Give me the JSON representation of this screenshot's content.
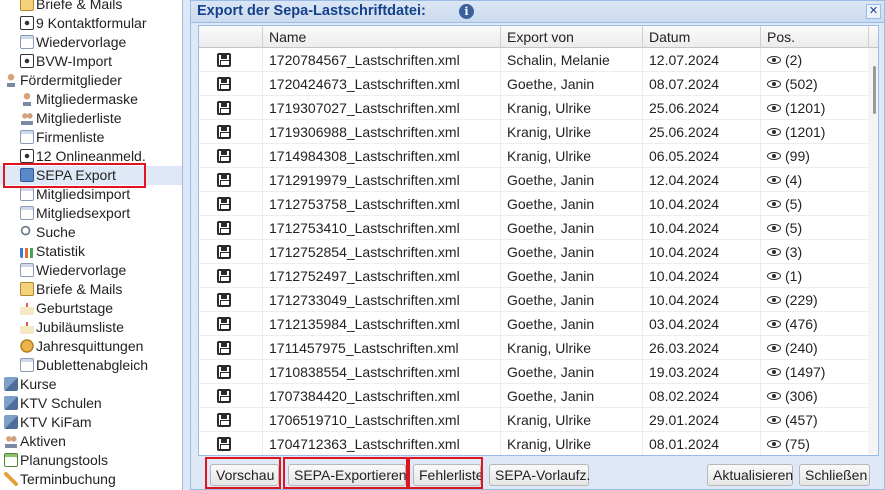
{
  "sidebar": {
    "items": [
      {
        "label": "Briefe & Mails",
        "icon": "mail-icon",
        "level": 1
      },
      {
        "label": "9  Kontaktformular",
        "icon": "eye-icon",
        "level": 1
      },
      {
        "label": "Wiedervorlage",
        "icon": "document-icon",
        "level": 1
      },
      {
        "label": "BVW-Import",
        "icon": "eye-icon",
        "level": 1
      },
      {
        "label": "Fördermitglieder",
        "icon": "person-icon",
        "level": 0
      },
      {
        "label": "Mitgliedermaske",
        "icon": "person-icon",
        "level": 1
      },
      {
        "label": "Mitgliederliste",
        "icon": "group-icon",
        "level": 1
      },
      {
        "label": "Firmenliste",
        "icon": "document-icon",
        "level": 1
      },
      {
        "label": "12  Onlineanmeld.",
        "icon": "eye-icon",
        "level": 1
      },
      {
        "label": "SEPA Export",
        "icon": "sepa-icon",
        "level": 1,
        "selected": true
      },
      {
        "label": "Mitgliedsimport",
        "icon": "document-icon",
        "level": 1
      },
      {
        "label": "Mitgliedsexport",
        "icon": "document-icon",
        "level": 1
      },
      {
        "label": "Suche",
        "icon": "search-icon",
        "level": 1
      },
      {
        "label": "Statistik",
        "icon": "bar-chart-icon",
        "level": 1
      },
      {
        "label": "Wiedervorlage",
        "icon": "document-icon",
        "level": 1
      },
      {
        "label": "Briefe & Mails",
        "icon": "mail-icon",
        "level": 1
      },
      {
        "label": "Geburtstage",
        "icon": "cake-icon",
        "level": 1
      },
      {
        "label": "Jubiläumsliste",
        "icon": "cake-icon",
        "level": 1
      },
      {
        "label": "Jahresquittungen",
        "icon": "coin-icon",
        "level": 1
      },
      {
        "label": "Dublettenabgleich",
        "icon": "document-icon",
        "level": 1
      },
      {
        "label": "Kurse",
        "icon": "cube-icon",
        "level": 0
      },
      {
        "label": "KTV Schulen",
        "icon": "cube-icon",
        "level": 0
      },
      {
        "label": "KTV KiFam",
        "icon": "cube-icon",
        "level": 0
      },
      {
        "label": "Aktiven",
        "icon": "group-icon",
        "level": 0
      },
      {
        "label": "Planungstools",
        "icon": "calendar-icon",
        "level": 0
      },
      {
        "label": "Terminbuchung",
        "icon": "pencil-icon",
        "level": 0
      }
    ]
  },
  "dialog": {
    "title": "Export der Sepa-Lastschriftdatei:",
    "close_glyph": "✕",
    "info_glyph": "i",
    "columns": [
      "",
      "Name",
      "Export von",
      "Datum",
      "Pos."
    ],
    "rows": [
      {
        "name": "1720784567_Lastschriften.xml",
        "export_von": "Schalin, Melanie",
        "datum": "12.07.2024",
        "pos": "(2)"
      },
      {
        "name": "1720424673_Lastschriften.xml",
        "export_von": "Goethe, Janin",
        "datum": "08.07.2024",
        "pos": "(502)"
      },
      {
        "name": "1719307027_Lastschriften.xml",
        "export_von": "Kranig, Ulrike",
        "datum": "25.06.2024",
        "pos": "(1201)"
      },
      {
        "name": "1719306988_Lastschriften.xml",
        "export_von": "Kranig, Ulrike",
        "datum": "25.06.2024",
        "pos": "(1201)"
      },
      {
        "name": "1714984308_Lastschriften.xml",
        "export_von": "Kranig, Ulrike",
        "datum": "06.05.2024",
        "pos": "(99)"
      },
      {
        "name": "1712919979_Lastschriften.xml",
        "export_von": "Goethe, Janin",
        "datum": "12.04.2024",
        "pos": "(4)"
      },
      {
        "name": "1712753758_Lastschriften.xml",
        "export_von": "Goethe, Janin",
        "datum": "10.04.2024",
        "pos": "(5)"
      },
      {
        "name": "1712753410_Lastschriften.xml",
        "export_von": "Goethe, Janin",
        "datum": "10.04.2024",
        "pos": "(5)"
      },
      {
        "name": "1712752854_Lastschriften.xml",
        "export_von": "Goethe, Janin",
        "datum": "10.04.2024",
        "pos": "(3)"
      },
      {
        "name": "1712752497_Lastschriften.xml",
        "export_von": "Goethe, Janin",
        "datum": "10.04.2024",
        "pos": "(1)"
      },
      {
        "name": "1712733049_Lastschriften.xml",
        "export_von": "Goethe, Janin",
        "datum": "10.04.2024",
        "pos": "(229)"
      },
      {
        "name": "1712135984_Lastschriften.xml",
        "export_von": "Goethe, Janin",
        "datum": "03.04.2024",
        "pos": "(476)"
      },
      {
        "name": "1711457975_Lastschriften.xml",
        "export_von": "Kranig, Ulrike",
        "datum": "26.03.2024",
        "pos": "(240)"
      },
      {
        "name": "1710838554_Lastschriften.xml",
        "export_von": "Goethe, Janin",
        "datum": "19.03.2024",
        "pos": "(1497)"
      },
      {
        "name": "1707384420_Lastschriften.xml",
        "export_von": "Goethe, Janin",
        "datum": "08.02.2024",
        "pos": "(306)"
      },
      {
        "name": "1706519710_Lastschriften.xml",
        "export_von": "Kranig, Ulrike",
        "datum": "29.01.2024",
        "pos": "(457)"
      },
      {
        "name": "1704712363_Lastschriften.xml",
        "export_von": "Kranig, Ulrike",
        "datum": "08.01.2024",
        "pos": "(75)"
      }
    ]
  },
  "buttons": {
    "vorschau": "Vorschau",
    "sepa_exportieren": "SEPA-Exportieren",
    "fehlerliste": "Fehlerliste",
    "sepa_vorlaufz": "SEPA-Vorlaufz.",
    "aktualisieren": "Aktualisieren",
    "schliessen": "Schließen"
  },
  "colors": {
    "highlight": "#e0141e",
    "title": "#15428b",
    "panel_border": "#99bbe8",
    "panel_bg": "#dfe8f6"
  }
}
